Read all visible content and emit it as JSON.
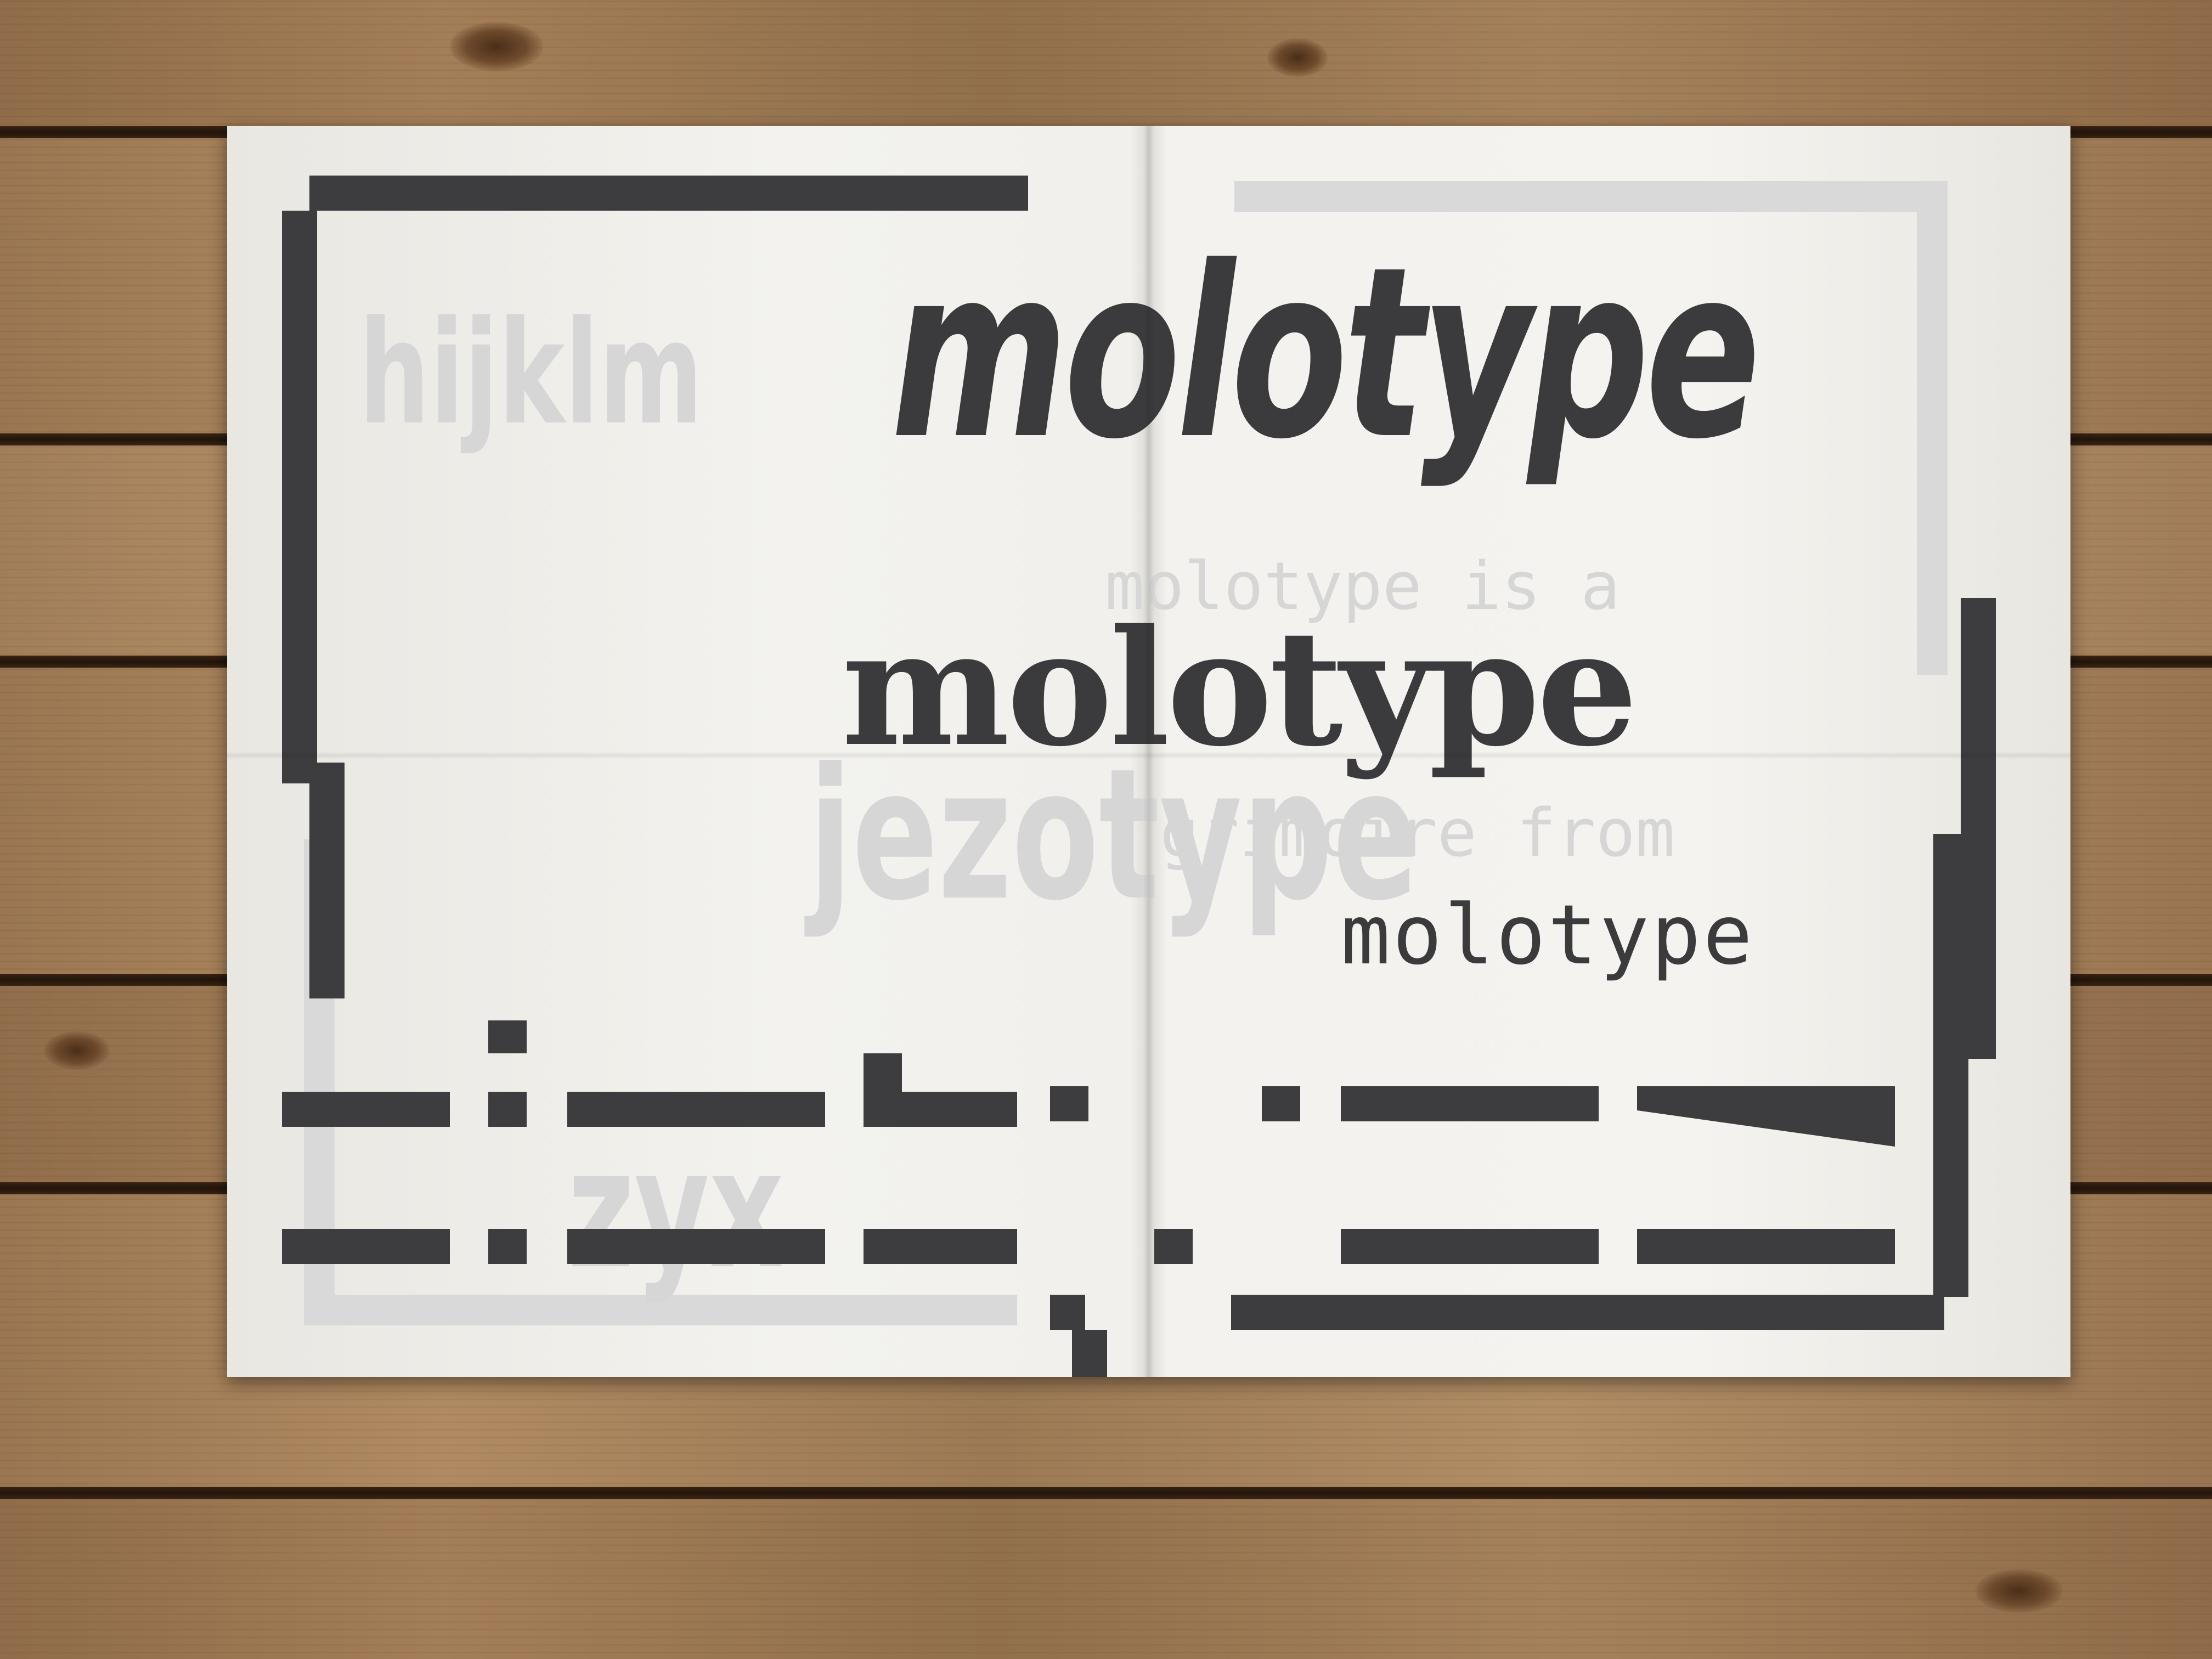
{
  "poster": {
    "headline_large": "molotype",
    "headline_medium": "molotype",
    "headline_pixel": "molotype",
    "ghost_line_1": "hijklm",
    "ghost_line_2": "molotype is a",
    "ghost_line_3": "jezotype",
    "ghost_line_4": "grimoire from",
    "ghost_line_5": "zyx"
  },
  "colors": {
    "ink": "#3b3b3d",
    "ghost": "#d6d6d6",
    "paper": "#f3f2ee",
    "wood": "#a8825b"
  }
}
